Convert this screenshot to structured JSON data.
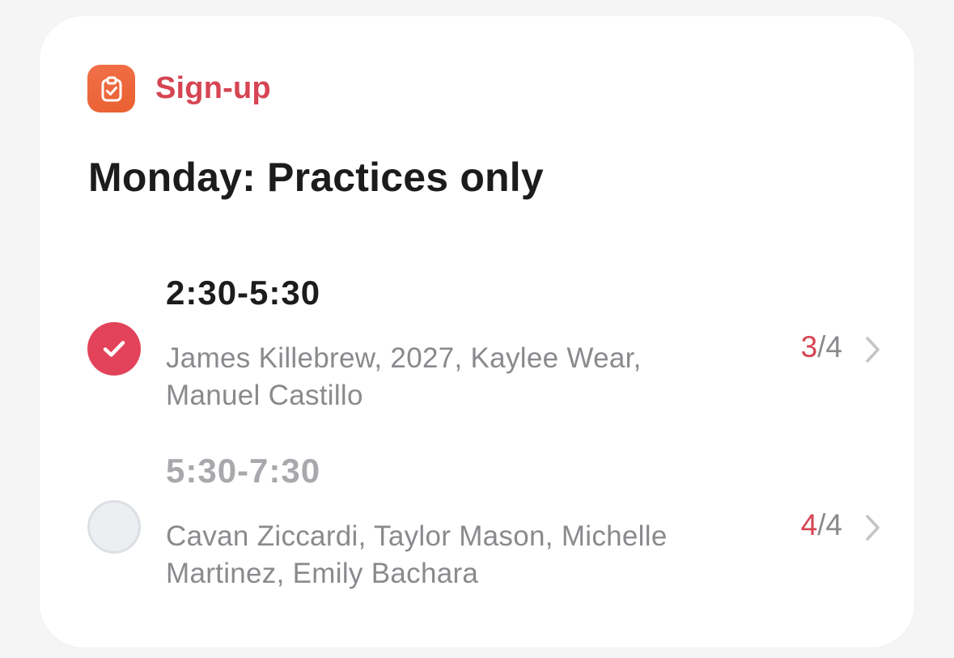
{
  "app": {
    "name": "Sign-up",
    "icon": "clipboard-check-icon",
    "accent_color": "#d64553",
    "icon_color": "#ee6a3e"
  },
  "title": "Monday: Practices only",
  "slots": [
    {
      "time": "2:30-5:30",
      "names": "James Killebrew, 2027, Kaylee Wear, Manuel Castillo",
      "filled": "3",
      "capacity": "/4",
      "selected": true
    },
    {
      "time": "5:30-7:30",
      "names": "Cavan Ziccardi, Taylor Mason, Michelle Martinez, Emily Bachara",
      "filled": "4",
      "capacity": "/4",
      "selected": false
    }
  ],
  "icons": {
    "selected": "checkmark-icon",
    "navigate": "chevron-right-icon"
  }
}
